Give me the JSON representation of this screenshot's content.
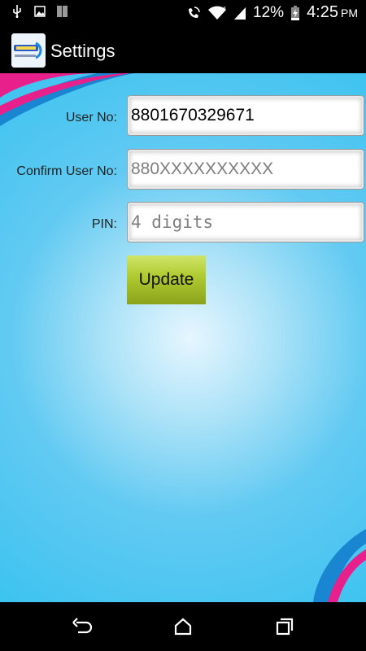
{
  "status_bar": {
    "battery_percent": "12%",
    "time": "4:25",
    "ampm": "PM"
  },
  "action_bar": {
    "title": "Settings"
  },
  "form": {
    "user_no_label": "User No:",
    "user_no_value": "8801670329671",
    "confirm_label": "Confirm User No:",
    "confirm_placeholder": "880XXXXXXXXXX",
    "pin_label": "PIN:",
    "pin_placeholder": "4 digits",
    "update_label": "Update"
  },
  "colors": {
    "background": "#3cc3f0",
    "accent_pink": "#e8208b",
    "accent_blue": "#1a86d1",
    "button": "#a8c22a"
  }
}
